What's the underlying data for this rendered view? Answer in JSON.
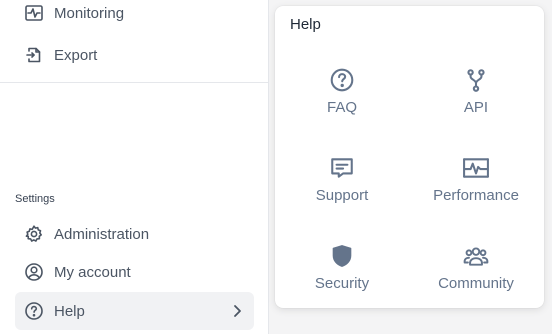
{
  "sidebar": {
    "items_top": [
      {
        "label": "Monitoring",
        "icon": "monitoring-icon"
      },
      {
        "label": "Export",
        "icon": "export-icon"
      }
    ],
    "settings_label": "Settings",
    "items_settings": [
      {
        "label": "Administration",
        "icon": "gear-icon"
      },
      {
        "label": "My account",
        "icon": "user-circle-icon"
      },
      {
        "label": "Help",
        "icon": "question-circle-icon",
        "active": true
      }
    ]
  },
  "help_menu": {
    "title": "Help",
    "tiles": [
      {
        "label": "FAQ",
        "icon": "question-circle-icon"
      },
      {
        "label": "API",
        "icon": "branch-icon"
      },
      {
        "label": "Support",
        "icon": "chat-icon"
      },
      {
        "label": "Performance",
        "icon": "pulse-icon"
      },
      {
        "label": "Security",
        "icon": "shield-icon"
      },
      {
        "label": "Community",
        "icon": "users-icon"
      }
    ]
  },
  "colors": {
    "icon": "#64748b",
    "text": "#4b5563",
    "active_bg": "#f1f2f4"
  }
}
